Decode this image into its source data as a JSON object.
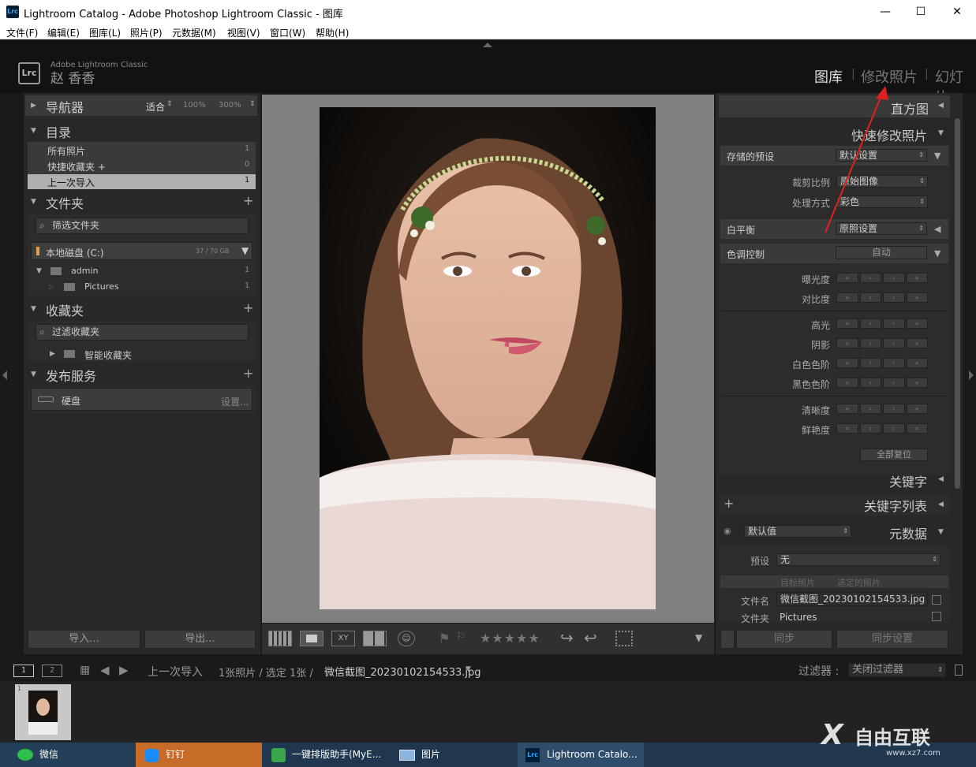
{
  "window": {
    "title": "Lightroom Catalog - Adobe Photoshop Lightroom Classic - 图库",
    "app_icon": "Lrc",
    "minimize": "—",
    "maximize": "☐",
    "close": "✕"
  },
  "menu": [
    "文件(F)",
    "编辑(E)",
    "图库(L)",
    "照片(P)",
    "元数据(M)",
    "视图(V)",
    "窗口(W)",
    "帮助(H)"
  ],
  "identity": {
    "logo": "Lrc",
    "product": "Adobe Lightroom Classic",
    "user": "赵 香香"
  },
  "modules": [
    "图库",
    "修改照片",
    "幻灯片"
  ],
  "navigator": {
    "title": "导航器",
    "fit": "适合",
    "z1": "100%",
    "z2": "300%"
  },
  "catalog": {
    "title": "目录",
    "items": [
      {
        "label": "所有照片",
        "count": "1"
      },
      {
        "label": "快捷收藏夹 +",
        "count": "0"
      },
      {
        "label": "上一次导入",
        "count": "1"
      }
    ]
  },
  "folders": {
    "title": "文件夹",
    "filter_placeholder": "筛选文件夹",
    "disk": "本地磁盘 (C:)",
    "disk_size": "37 / 70 GB",
    "items": [
      {
        "label": "admin",
        "count": "1"
      },
      {
        "label": "Pictures",
        "count": "1"
      }
    ]
  },
  "collections": {
    "title": "收藏夹",
    "filter_placeholder": "过滤收藏夹",
    "smart": "智能收藏夹"
  },
  "publish": {
    "title": "发布服务",
    "disk": "硬盘",
    "setup": "设置..."
  },
  "left_buttons": {
    "import": "导入...",
    "export": "导出..."
  },
  "right": {
    "histogram": "直方图",
    "quick_develop": "快速修改照片",
    "saved_preset_label": "存储的预设",
    "saved_preset": "默认设置",
    "crop_label": "裁剪比例",
    "crop": "原始图像",
    "treatment_label": "处理方式",
    "treatment": "彩色",
    "wb_label": "白平衡",
    "wb": "原照设置",
    "tone_label": "色调控制",
    "auto": "自动",
    "sliders": [
      "曝光度",
      "对比度",
      "高光",
      "阴影",
      "白色色阶",
      "黑色色阶",
      "清晰度",
      "鲜艳度"
    ],
    "reset_all": "全部复位",
    "keywording": "关键字",
    "keyword_list": "关键字列表",
    "metadata_default": "默认值",
    "metadata": "元数据",
    "preset_label": "预设",
    "preset": "无",
    "target_photo": "目标照片",
    "selected_photo": "选定的照片",
    "filename_label": "文件名",
    "filename": "微信截图_20230102154533.jpg",
    "folder_label": "文件夹",
    "folder": "Pictures",
    "sync": "同步",
    "sync_settings": "同步设置"
  },
  "filmstrip": {
    "page1": "1",
    "page2": "2",
    "source": "上一次导入",
    "info": "1张照片 / 选定 1张 /",
    "filename": "微信截图_20230102154533.jpg",
    "filter_label": "过滤器 :",
    "filter": "关闭过滤器",
    "thumb_num": "1"
  },
  "taskbar": [
    {
      "label": "微信",
      "icon": "wechat-icon"
    },
    {
      "label": "钉钉",
      "icon": "dingtalk-icon"
    },
    {
      "label": "一键排版助手(MyE...",
      "icon": "app-icon"
    },
    {
      "label": "图片",
      "icon": "photos-icon"
    },
    {
      "label": "Lightroom Catalo...",
      "icon": "lrc-icon"
    }
  ],
  "watermark": "自由互联",
  "watermark_url": "www.xz7.com"
}
